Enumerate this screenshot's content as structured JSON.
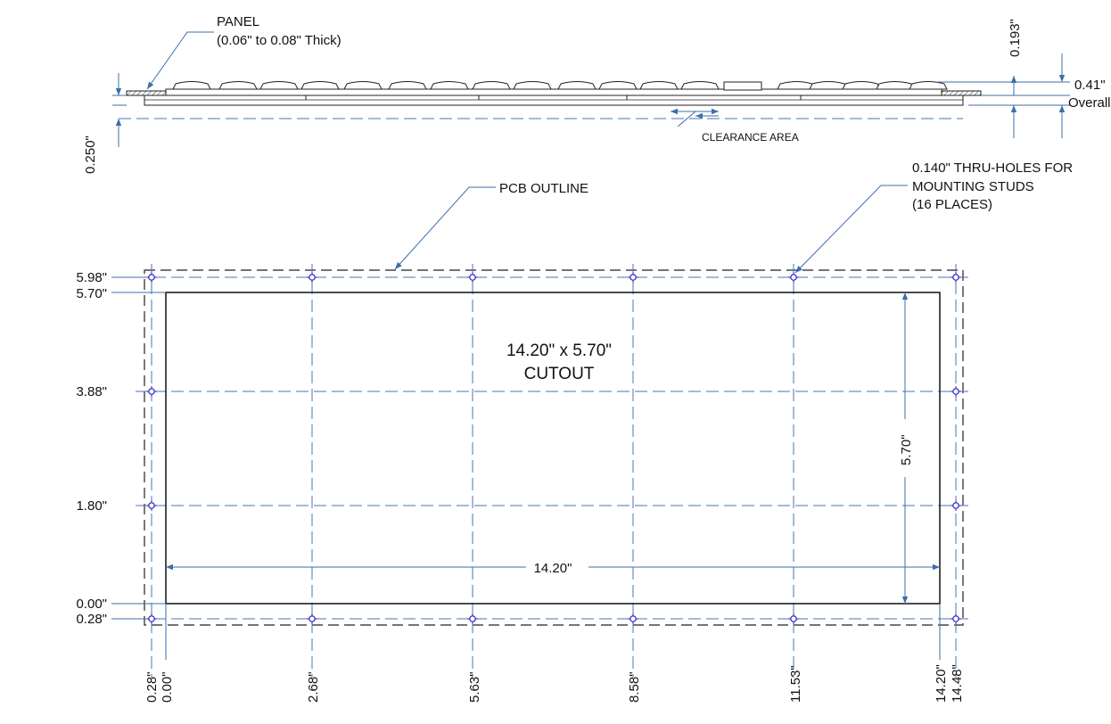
{
  "side_view": {
    "panel_label": "PANEL",
    "panel_thickness": "(0.06\" to 0.08\" Thick)",
    "dim_top": "0.193\"",
    "dim_overall_value": "0.41\"",
    "dim_overall_label": "Overall",
    "dim_clearance": "0.250\"",
    "clearance_label": "CLEARANCE AREA"
  },
  "top_view": {
    "pcb_label": "PCB OUTLINE",
    "holes_label_line1": "0.140\" THRU-HOLES FOR",
    "holes_label_line2": "MOUNTING STUDS",
    "holes_label_line3": "(16 PLACES)",
    "cutout_line1": "14.20\" x 5.70\"",
    "cutout_line2": "CUTOUT",
    "width_dim": "14.20\"",
    "height_dim": "5.70\"",
    "y_labels": [
      "5.98\"",
      "5.70\"",
      "3.88\"",
      "1.80\"",
      "0.00\"",
      "0.28\""
    ],
    "x_labels": [
      "0.28\"",
      "0.00\"",
      "2.68\"",
      "5.63\"",
      "8.58\"",
      "11.53\"",
      "14.20\"",
      "14.48\""
    ]
  }
}
